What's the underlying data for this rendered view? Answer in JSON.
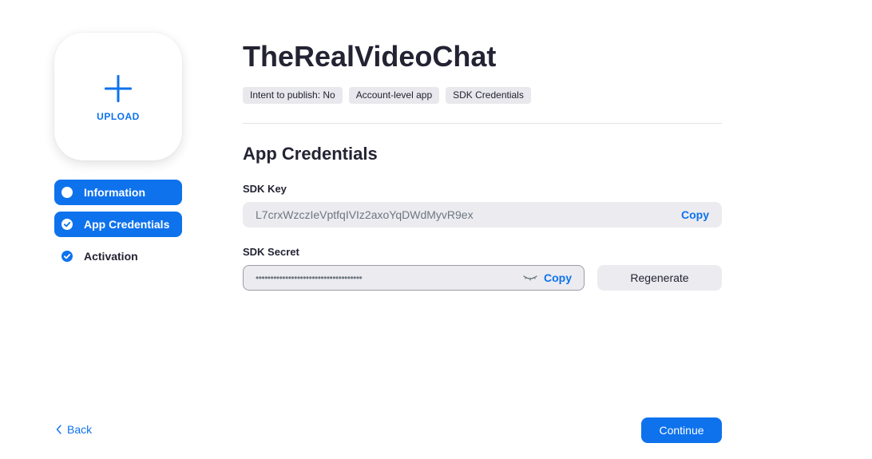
{
  "colors": {
    "accent": "#0e72ed",
    "text": "#232333",
    "input_bg": "#ebebf0"
  },
  "upload": {
    "label": "UPLOAD",
    "icon": "plus-icon"
  },
  "steps": [
    {
      "label": "Information",
      "state": "active",
      "icon": "dot-icon"
    },
    {
      "label": "App Credentials",
      "state": "active",
      "icon": "check-circle-icon"
    },
    {
      "label": "Activation",
      "state": "done",
      "icon": "check-circle-icon"
    }
  ],
  "app": {
    "title": "TheRealVideoChat",
    "tags": [
      "Intent to publish: No",
      "Account-level app",
      "SDK Credentials"
    ]
  },
  "credentials": {
    "section_title": "App Credentials",
    "sdk_key": {
      "label": "SDK Key",
      "value": "L7crxWzczIeVptfqIVIz2axoYqDWdMyvR9ex",
      "copy_label": "Copy"
    },
    "sdk_secret": {
      "label": "SDK Secret",
      "value": "••••••••••••••••••••••••••••••••••••",
      "copy_label": "Copy",
      "toggle_icon": "eye-closed-icon"
    },
    "regenerate_label": "Regenerate"
  },
  "footer": {
    "back_label": "Back",
    "continue_label": "Continue"
  }
}
